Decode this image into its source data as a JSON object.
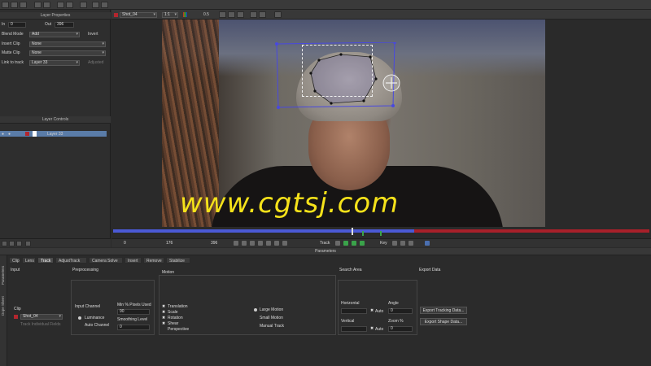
{
  "viewer": {
    "clip_name": "Shot_04",
    "zoom": "1:1",
    "opacity": "0.5",
    "watermark": "www.cgtsj.com"
  },
  "layer_properties": {
    "title": "Layer Properties",
    "in_label": "In",
    "in_value": "0",
    "out_label": "Out",
    "out_value": "396",
    "blend_mode_label": "Blend Mode",
    "blend_mode_value": "Add",
    "invert_label": "Invert",
    "insert_clip_label": "Insert Clip",
    "insert_clip_value": "None",
    "matte_clip_label": "Matte Clip",
    "matte_clip_value": "None",
    "link_to_track_label": "Link to track",
    "link_to_track_value": "Layer 33",
    "adjusted_label": "Adjusted"
  },
  "layer_controls": {
    "title": "Layer Controls",
    "layer_name": "Layer 33"
  },
  "transport": {
    "frame_start": "0",
    "frame_in": "176",
    "frame_out": "396",
    "track_label": "Track",
    "key_label": "Key"
  },
  "parameters": {
    "title": "Parameters",
    "side_tabs": [
      "Parameters",
      "Dope Sheet"
    ],
    "tabs": [
      "Clip",
      "Lens",
      "Track",
      "AdjustTrack",
      "Camera Solve",
      "Insert",
      "Remove",
      "Stabilize"
    ],
    "active_tab": "Track",
    "input": {
      "title": "Input",
      "clip_label": "Clip",
      "clip_value": "Shot_04",
      "track_individual_fields": "Track Individual Fields"
    },
    "preprocessing": {
      "title": "Preprocessing",
      "input_channel_label": "Input Channel",
      "luminance": "Luminance",
      "auto_channel": "Auto Channel",
      "min_pixels_label": "Min % Pixels Used",
      "min_pixels_value": "90",
      "smoothing_label": "Smoothing Level",
      "smoothing_value": "0"
    },
    "motion": {
      "title": "Motion",
      "translation": "Translation",
      "scale": "Scale",
      "rotation": "Rotation",
      "shear": "Shear",
      "perspective": "Perspective",
      "large_motion": "Large Motion",
      "small_motion": "Small Motion",
      "manual_track": "Manual Track"
    },
    "search_area": {
      "title": "Search Area",
      "horizontal_label": "Horizontal",
      "vertical_label": "Vertical",
      "auto_label": "Auto",
      "angle_label": "Angle",
      "angle_value": "0",
      "zoom_label": "Zoom %",
      "zoom_value": "0",
      "h_auto_value": "0"
    },
    "export_data": {
      "title": "Export Data",
      "export_tracking": "Export Tracking Data...",
      "export_shape": "Export Shape Data..."
    }
  }
}
